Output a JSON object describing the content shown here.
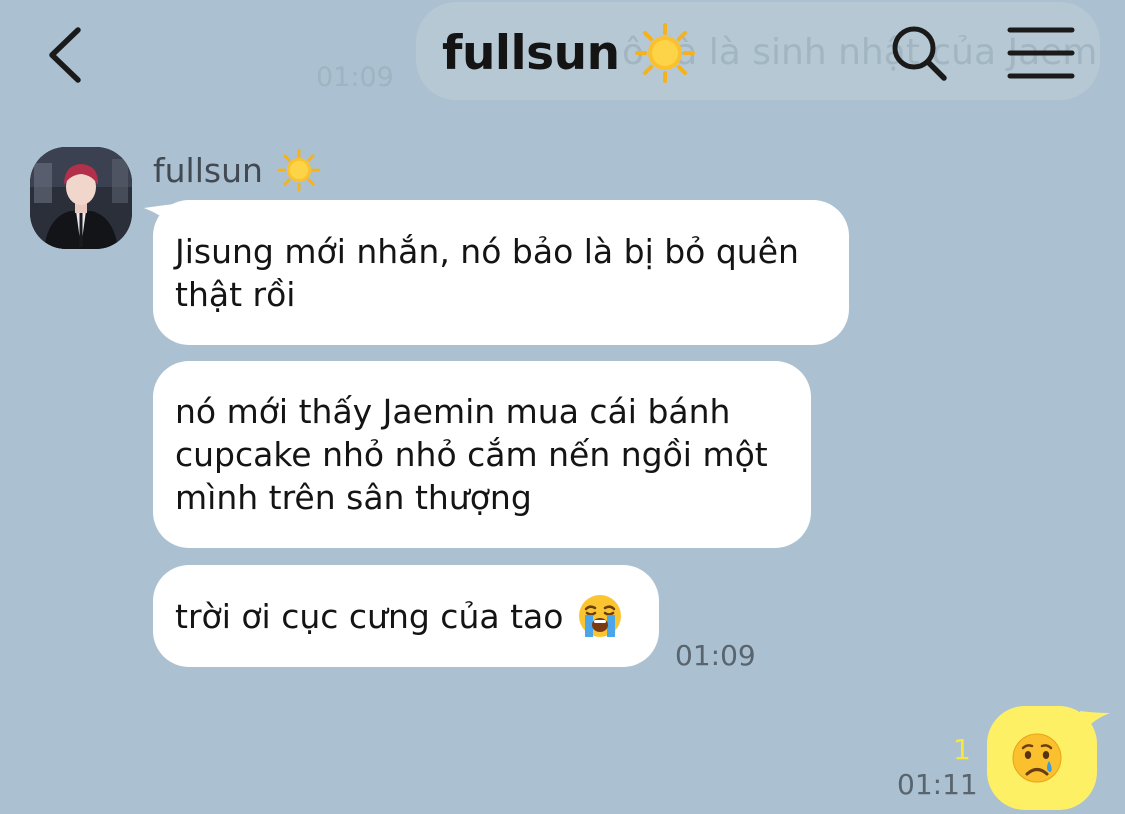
{
  "header": {
    "title": "fullsun",
    "title_icon": "sun-emoji",
    "back_icon": "chevron-left-icon",
    "search_icon": "search-icon",
    "menu_icon": "hamburger-menu-icon",
    "pinned_preview": "ô cà là sinh nhật của Jaemin",
    "background_time": "01:09"
  },
  "conversation": {
    "incoming": {
      "sender_name": "fullsun",
      "sender_icon": "sun-emoji",
      "messages": [
        {
          "text": "Jisung mới nhắn, nó bảo là bị bỏ quên thật rồi"
        },
        {
          "text": "nó mới thấy Jaemin mua cái bánh cupcake nhỏ nhỏ cắm nến ngồi một mình trên sân thượng"
        },
        {
          "text": "trời ơi cục cưng của tao",
          "emoji": "loudly-crying-face-emoji"
        }
      ],
      "time": "01:09"
    },
    "outgoing": {
      "emoji": "crying-face-emoji",
      "unread_count": "1",
      "time": "01:11"
    }
  },
  "colors": {
    "background": "#abc1d1",
    "incoming_bubble": "#ffffff",
    "outgoing_bubble": "#fef065",
    "unread_count": "#f7e63b"
  }
}
